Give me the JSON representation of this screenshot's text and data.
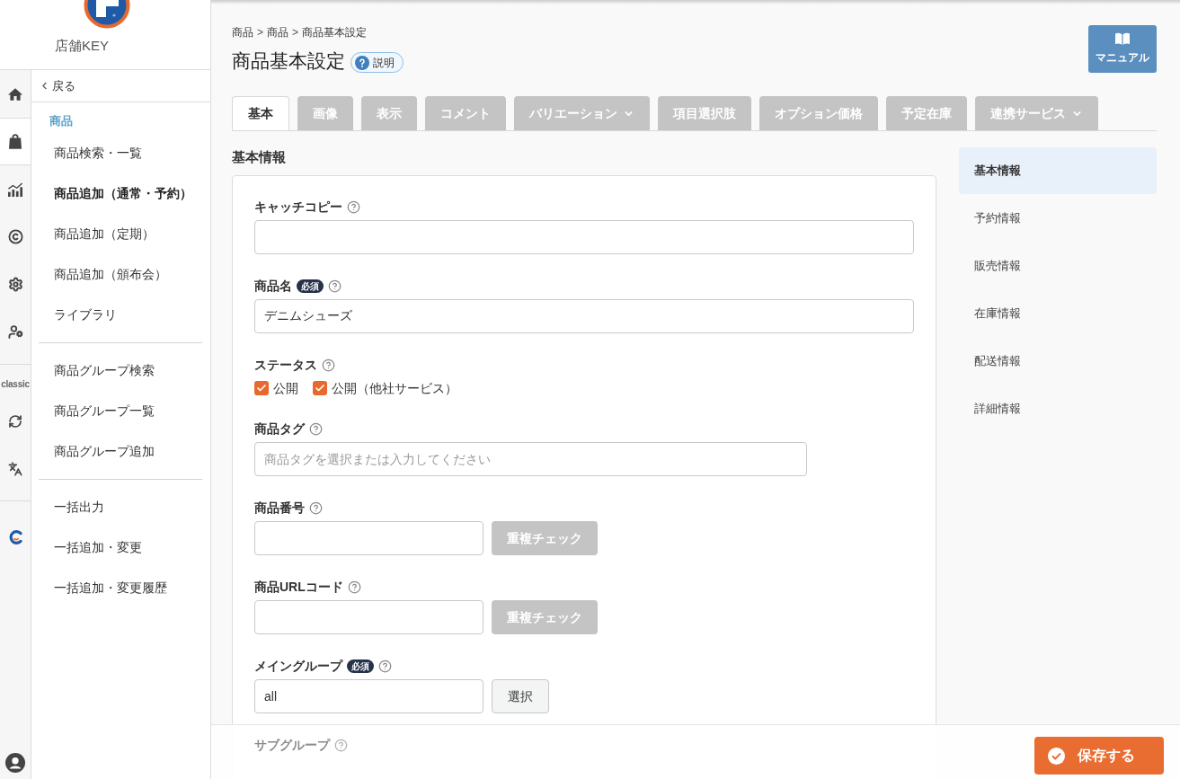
{
  "sidebar": {
    "store_label": "店舗KEY",
    "rail": [
      {
        "items": [
          {
            "kind": "home",
            "selected": false
          },
          {
            "kind": "bag",
            "selected": true
          },
          {
            "kind": "chart",
            "selected": false
          },
          {
            "kind": "copyright",
            "selected": false
          },
          {
            "kind": "gear",
            "selected": false
          },
          {
            "kind": "user_gear",
            "selected": false
          }
        ]
      },
      {
        "label": "classic",
        "items": [
          {
            "kind": "sync",
            "selected": false
          },
          {
            "kind": "translate",
            "selected": false
          }
        ]
      },
      {
        "items": [
          {
            "kind": "brand",
            "selected": false
          }
        ]
      }
    ],
    "back": "戻る",
    "section_title": "商品",
    "menu_groups": [
      [
        {
          "label": "商品検索・一覧",
          "selected": false
        },
        {
          "label": "商品追加（通常・予約）",
          "selected": true
        },
        {
          "label": "商品追加（定期）",
          "selected": false
        },
        {
          "label": "商品追加（頒布会）",
          "selected": false
        },
        {
          "label": "ライブラリ",
          "selected": false
        }
      ],
      [
        {
          "label": "商品グループ検索",
          "selected": false
        },
        {
          "label": "商品グループ一覧",
          "selected": false
        },
        {
          "label": "商品グループ追加",
          "selected": false
        }
      ],
      [
        {
          "label": "一括出力",
          "selected": false
        },
        {
          "label": "一括追加・変更",
          "selected": false
        },
        {
          "label": "一括追加・変更履歴",
          "selected": false
        }
      ]
    ]
  },
  "breadcrumb": {
    "items": [
      "商品",
      "商品",
      "商品基本設定"
    ],
    "separator": ">"
  },
  "page_title": "商品基本設定",
  "help_button": "説明",
  "manual_button": "マニュアル",
  "tabs": [
    {
      "label": "基本",
      "selected": true,
      "dropdown": false
    },
    {
      "label": "画像",
      "selected": false,
      "dropdown": false
    },
    {
      "label": "表示",
      "selected": false,
      "dropdown": false
    },
    {
      "label": "コメント",
      "selected": false,
      "dropdown": false
    },
    {
      "label": "バリエーション",
      "selected": false,
      "dropdown": true
    },
    {
      "label": "項目選択肢",
      "selected": false,
      "dropdown": false
    },
    {
      "label": "オプション価格",
      "selected": false,
      "dropdown": false
    },
    {
      "label": "予定在庫",
      "selected": false,
      "dropdown": false
    },
    {
      "label": "連携サービス",
      "selected": false,
      "dropdown": true
    }
  ],
  "section_title": "基本情報",
  "fields": [
    {
      "kind": "text",
      "label": "キャッチコピー"
    },
    {
      "kind": "text",
      "label": "商品名",
      "badge": "必須",
      "value": "デニムシューズ"
    },
    {
      "kind": "checkboxes",
      "label": "ステータス",
      "options": [
        {
          "label": "公開",
          "checked": true
        },
        {
          "label": "公開（他社サービス）",
          "checked": true
        }
      ]
    },
    {
      "kind": "tags",
      "label": "商品タグ",
      "placeholder": "商品タグを選択または入力してください"
    },
    {
      "kind": "text_button",
      "label": "商品番号",
      "button": {
        "label": "重複チェック",
        "disabled": true
      }
    },
    {
      "kind": "text_button",
      "label": "商品URLコード",
      "button": {
        "label": "重複チェック",
        "disabled": true
      }
    },
    {
      "kind": "text_button",
      "label": "メイングループ",
      "badge": "必須",
      "value": "all",
      "button": {
        "label": "選択",
        "disabled": false
      }
    },
    {
      "kind": "label",
      "label": "サブグループ"
    }
  ],
  "section_nav": [
    {
      "label": "基本情報",
      "selected": true
    },
    {
      "label": "予約情報",
      "selected": false
    },
    {
      "label": "販売情報",
      "selected": false
    },
    {
      "label": "在庫情報",
      "selected": false
    },
    {
      "label": "配送情報",
      "selected": false
    },
    {
      "label": "詳細情報",
      "selected": false
    }
  ],
  "save_button": "保存する"
}
